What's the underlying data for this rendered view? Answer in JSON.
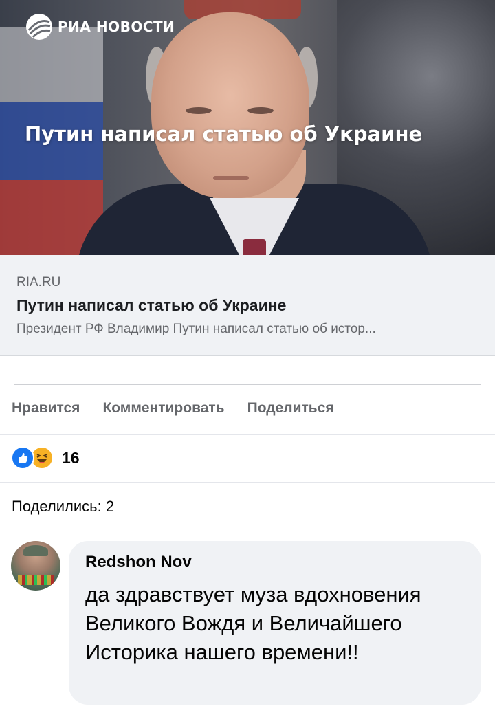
{
  "preview": {
    "brand": "РИА НОВОСТИ",
    "overlay_title": "Путин написал статью об Украине"
  },
  "link": {
    "domain": "RIA.RU",
    "title": "Путин написал статью об Украине",
    "description": "Президент РФ Владимир Путин написал статью об истор..."
  },
  "actions": {
    "like": "Нравится",
    "comment": "Комментировать",
    "share": "Поделиться"
  },
  "reactions": {
    "icons": [
      "like-icon",
      "haha-icon"
    ],
    "count": "16"
  },
  "shares": "Поделились: 2",
  "comment": {
    "author": "Redshon Nov",
    "text": "да здравствует муза вдохновения Великого Вождя и Величайшего Историка нашего времени!!"
  },
  "colors": {
    "like_blue": "#1877f2",
    "haha_yellow": "#f7b125",
    "secondary_text": "#65676b",
    "bubble_bg": "#f0f2f5"
  }
}
